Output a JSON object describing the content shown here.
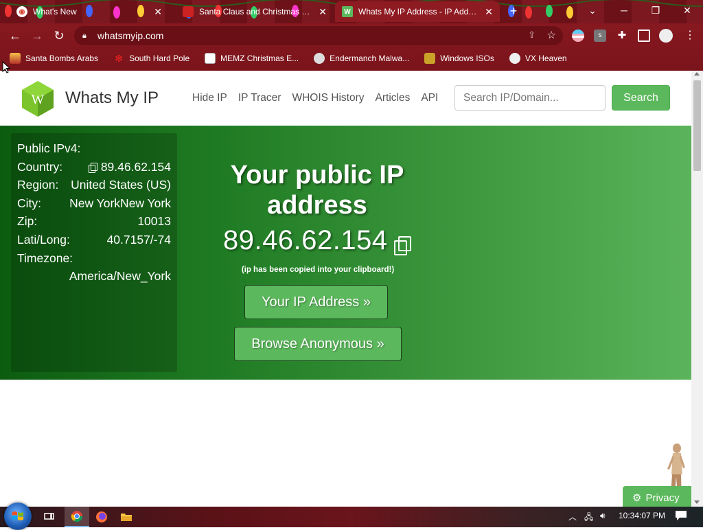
{
  "browser": {
    "tabs": [
      {
        "title": "What's New",
        "favicon": "chrome-icon",
        "active": false
      },
      {
        "title": "Santa Claus and Christmas at the",
        "favicon": "page-icon",
        "active": false
      },
      {
        "title": "Whats My IP Address - IP Address",
        "favicon": "whatsmyip-icon",
        "active": true
      }
    ],
    "new_tab": "+",
    "url": "whatsmyip.com",
    "bookmarks": [
      {
        "label": "Santa Bombs Arabs",
        "icon": "candle-icon"
      },
      {
        "label": "South Hard Pole",
        "icon": "snowflake-icon"
      },
      {
        "label": "MEMZ Christmas E...",
        "icon": "page-icon"
      },
      {
        "label": "Endermanch Malwa...",
        "icon": "skull-icon"
      },
      {
        "label": "Windows ISOs",
        "icon": "trophy-icon"
      },
      {
        "label": "VX Heaven",
        "icon": "biohazard-icon"
      }
    ]
  },
  "site": {
    "logo_letter": "W",
    "name": "Whats My IP",
    "nav": [
      "Hide IP",
      "IP Tracer",
      "WHOIS History",
      "Articles",
      "API"
    ],
    "search_placeholder": "Search IP/Domain...",
    "search_button": "Search"
  },
  "info": {
    "rows": [
      {
        "label": "Public IPv4:",
        "value": ""
      },
      {
        "label": "Country:",
        "value": "89.46.62.154"
      },
      {
        "label": "Region:",
        "value": "United States (US)"
      },
      {
        "label": "City:",
        "value": "New YorkNew York"
      },
      {
        "label": "Zip:",
        "value": "10013"
      },
      {
        "label": "Lati/Long:",
        "value": "40.7157/-74"
      },
      {
        "label": "Timezone:",
        "value": ""
      },
      {
        "label": "",
        "value": "America/New_York"
      }
    ]
  },
  "hero": {
    "title": "Your public IP address",
    "ip": "89.46.62.154",
    "note": "(ip has been copied into your clipboard!)",
    "btn_ip": "Your IP Address »",
    "btn_browse": "Browse Anonymous »"
  },
  "privacy_label": "Privacy",
  "taskbar": {
    "clock": "10:34:07 PM"
  },
  "colors": {
    "chrome_frame": "#8e1a22",
    "site_green": "#5cb85c",
    "hero_dark": "#0c5c10",
    "hero_light": "#5bb45b"
  }
}
